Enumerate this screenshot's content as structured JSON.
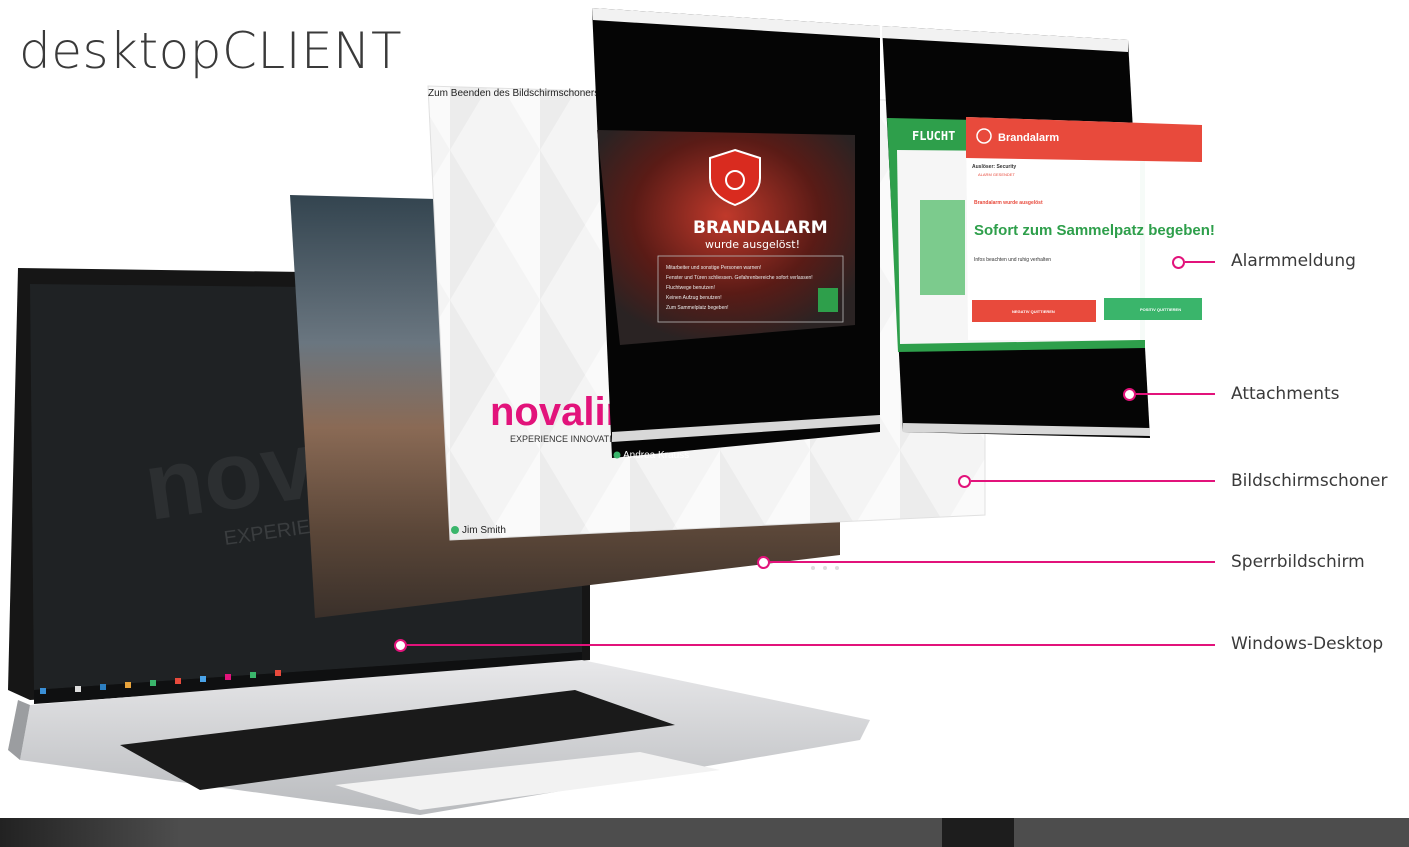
{
  "title": "desktopCLIENT",
  "screensaver": {
    "banner": "Zum Beenden des Bildschirmschoners, ES",
    "brand": "novalink",
    "tagline": "EXPERIENCE INNOVATION",
    "user": "Jim Smith"
  },
  "laptop": {
    "brand": "nova",
    "tagline": "EXPERIE"
  },
  "alarm_window_left": {
    "title": "BRANDALARM",
    "subtitle": "wurde ausgelöst!",
    "instructions": [
      "Mitarbeiter und sonstige Personen warnen!",
      "Fenster und Türen schliessen. Gefahrenbereiche sofort verlassen!",
      "Fluchtwege benutzen!",
      "Keinen Aufzug benutzen!",
      "Zum Sammelplatz begeben!"
    ],
    "user": "Andrea Krauss"
  },
  "alarm_window_right": {
    "plan_title": "FLUCHT",
    "popup_title": "Brandalarm",
    "popup_trigger": "Auslöser: Security",
    "popup_status": "ALARM GESENDET",
    "popup_info": "Brandalarm wurde ausgelöst",
    "popup_message": "Sofort zum Sammelpatz begeben!",
    "popup_hint": "Infos beachten und ruhig verhalten",
    "btn_negative": "NEGATIV QUITTIEREN",
    "btn_positive": "POSITIV QUITTIEREN"
  },
  "callouts": [
    {
      "label": "Alarmmeldung"
    },
    {
      "label": "Attachments"
    },
    {
      "label": "Bildschirmschoner"
    },
    {
      "label": "Sperrbildschirm"
    },
    {
      "label": "Windows-Desktop"
    }
  ],
  "colors": {
    "accent": "#e2137b",
    "alarm_red": "#e84a3c",
    "escape_green": "#2e9f4b",
    "positive_green": "#3ab56b"
  }
}
